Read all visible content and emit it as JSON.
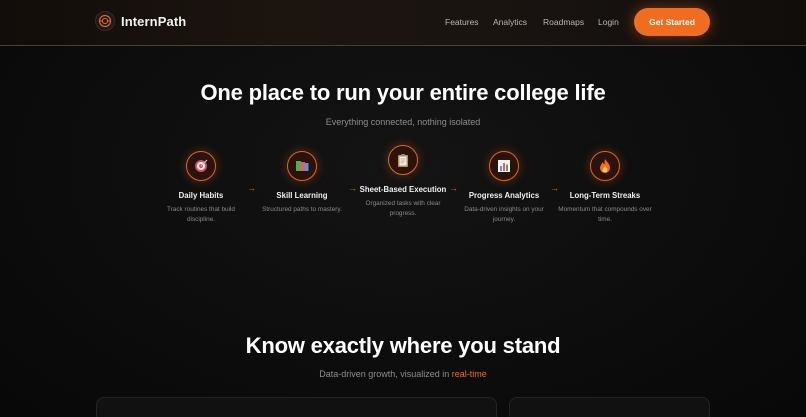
{
  "nav": {
    "brand": "InternPath",
    "links": [
      "Features",
      "Analytics",
      "Roadmaps",
      "Login"
    ],
    "cta": "Get Started"
  },
  "hero": {
    "title": "One place to run your entire college life",
    "subtitle": "Everything connected, nothing isolated"
  },
  "steps": [
    {
      "title": "Daily Habits",
      "desc": "Track routines that build discipline.",
      "icon": "target-icon"
    },
    {
      "title": "Skill Learning",
      "desc": "Structured paths to mastery.",
      "icon": "books-icon"
    },
    {
      "title": "Sheet-Based Execution",
      "desc": "Organized tasks with clear progress.",
      "icon": "clipboard-icon"
    },
    {
      "title": "Progress Analytics",
      "desc": "Data-driven insights on your journey.",
      "icon": "bar-chart-icon"
    },
    {
      "title": "Long-Term Streaks",
      "desc": "Momentum that compounds over time.",
      "icon": "flame-icon"
    }
  ],
  "arrow_glyph": "→",
  "section2": {
    "title": "Know exactly where you stand",
    "subtitle_prefix": "Data-driven growth, visualized in ",
    "subtitle_accent": "real-time"
  },
  "colors": {
    "accent": "#f06c1f",
    "background": "#0c0c0c"
  }
}
